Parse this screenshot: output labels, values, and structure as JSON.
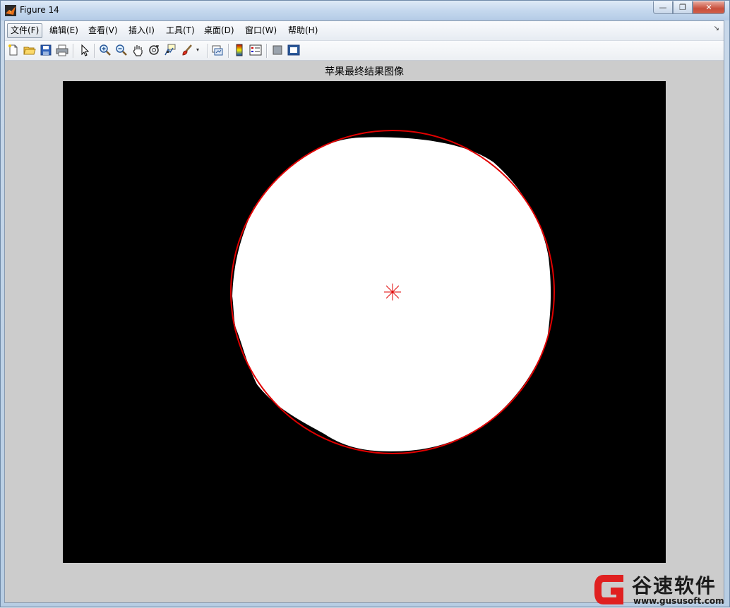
{
  "window": {
    "title": "Figure 14",
    "controls": {
      "minimize": "—",
      "restore": "❐",
      "close": "✕"
    }
  },
  "menubar": {
    "items": [
      {
        "label": "文件(F)"
      },
      {
        "label": "编辑(E)"
      },
      {
        "label": "查看(V)"
      },
      {
        "label": "插入(I)"
      },
      {
        "label": "工具(T)"
      },
      {
        "label": "桌面(D)"
      },
      {
        "label": "窗口(W)"
      },
      {
        "label": "帮助(H)"
      }
    ],
    "dock_arrow": "↘"
  },
  "toolbar": {
    "icons": [
      "new-figure-icon",
      "open-file-icon",
      "save-icon",
      "print-icon",
      "edit-plot-arrow-icon",
      "zoom-in-icon",
      "zoom-out-icon",
      "pan-hand-icon",
      "rotate-3d-icon",
      "data-cursor-icon",
      "brush-icon",
      "brush-dropdown-icon",
      "link-plot-icon",
      "insert-colorbar-icon",
      "insert-legend-icon",
      "hide-plot-tools-icon",
      "show-plot-tools-icon"
    ]
  },
  "figure": {
    "title": "苹果最终结果图像",
    "image_description_colors": {
      "background": "#000000",
      "blob": "#ffffff",
      "circle": "#e00000"
    }
  },
  "watermark": {
    "name": "谷速软件",
    "url": "www.gususoft.com"
  }
}
